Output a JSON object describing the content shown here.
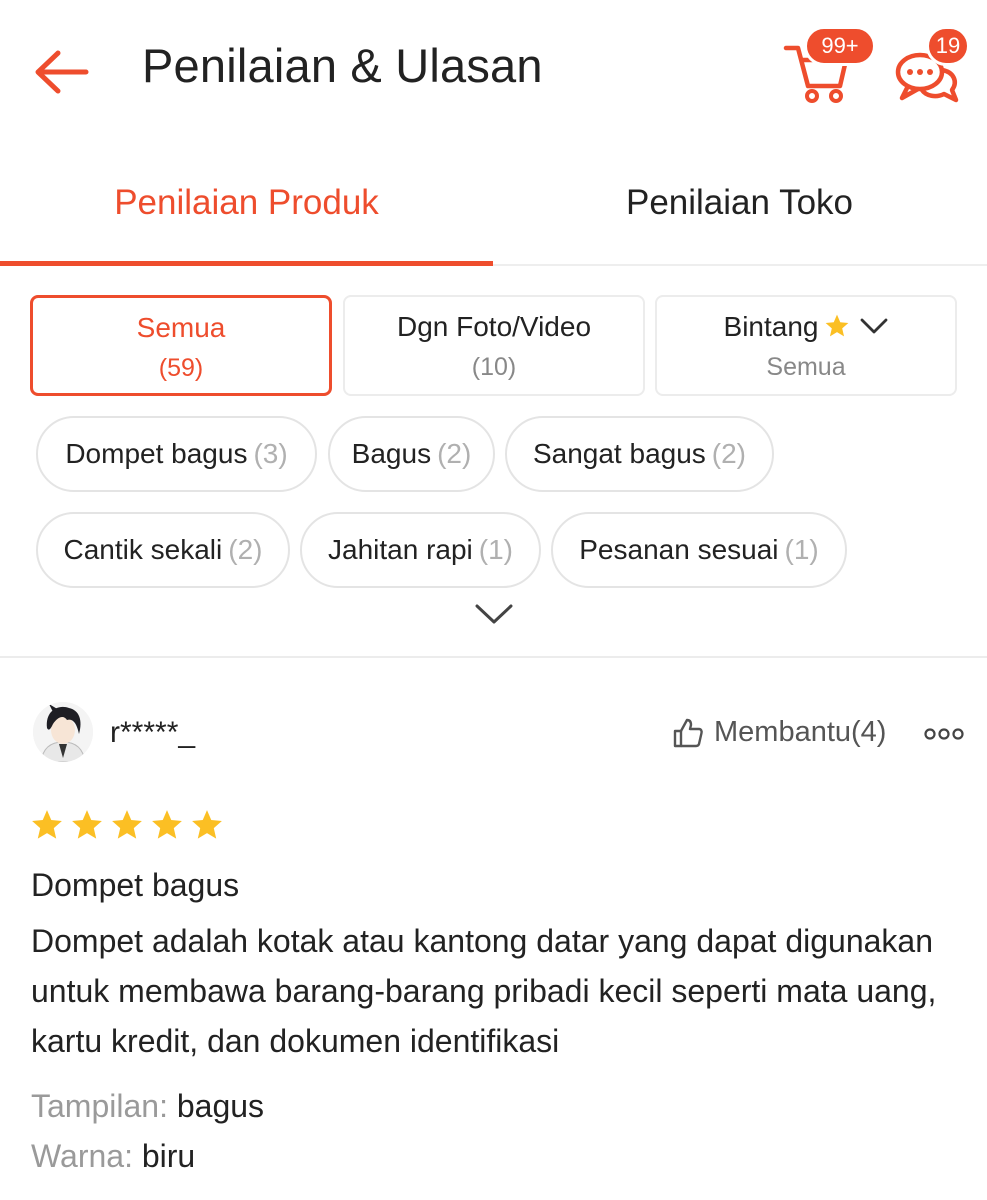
{
  "header": {
    "title": "Penilaian & Ulasan",
    "cart_badge": "99+",
    "chat_badge": "19"
  },
  "tabs": [
    {
      "label": "Penilaian Produk",
      "active": true
    },
    {
      "label": "Penilaian Toko",
      "active": false
    }
  ],
  "filters": [
    {
      "label": "Semua",
      "sub": "(59)",
      "active": true
    },
    {
      "label": "Dgn Foto/Video",
      "sub": "(10)",
      "active": false
    },
    {
      "label": "Bintang",
      "sub": "Semua",
      "active": false
    }
  ],
  "chips": [
    {
      "label": "Dompet bagus",
      "count": "(3)"
    },
    {
      "label": "Bagus",
      "count": "(2)"
    },
    {
      "label": "Sangat bagus",
      "count": "(2)"
    },
    {
      "label": "Cantik sekali",
      "count": "(2)"
    },
    {
      "label": "Jahitan rapi",
      "count": "(1)"
    },
    {
      "label": "Pesanan sesuai",
      "count": "(1)"
    }
  ],
  "review": {
    "username": "r*****_",
    "helpful": "Membantu(4)",
    "rating": 5,
    "title": "Dompet bagus",
    "body": "Dompet adalah kotak atau kantong datar yang dapat digunakan untuk membawa barang-barang pribadi kecil seperti mata uang, kartu kredit, dan dokumen identifikasi",
    "attributes": [
      {
        "key": "Tampilan:",
        "value": "bagus"
      },
      {
        "key": "Warna:",
        "value": "biru"
      }
    ]
  },
  "colors": {
    "accent": "#ee4d2d",
    "star": "#fbbf24"
  }
}
